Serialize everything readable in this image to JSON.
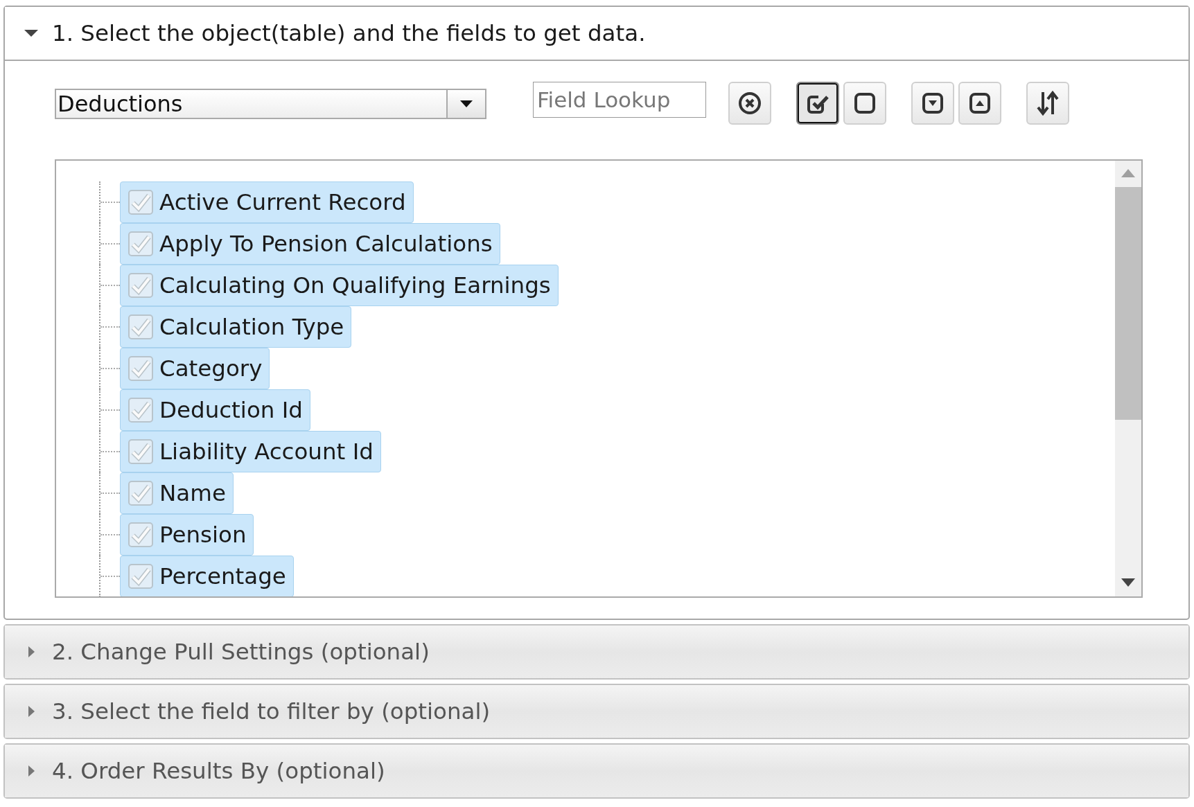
{
  "sections": [
    {
      "title": "1. Select the object(table) and the fields to get data.",
      "expanded": true,
      "object_select": {
        "value": "Deductions"
      },
      "field_lookup": {
        "placeholder": "Field Lookup"
      },
      "toolbar": [
        {
          "kind": "clear",
          "pressed": false
        },
        {
          "kind": "check-all",
          "pressed": true
        },
        {
          "kind": "uncheck-all",
          "pressed": false
        },
        {
          "kind": "expand",
          "pressed": false
        },
        {
          "kind": "collapse",
          "pressed": false
        },
        {
          "kind": "sort",
          "pressed": false
        }
      ],
      "fields": [
        {
          "label": "Active Current Record",
          "checked": true,
          "selected": true
        },
        {
          "label": "Apply To Pension Calculations",
          "checked": true,
          "selected": true
        },
        {
          "label": "Calculating On Qualifying Earnings",
          "checked": true,
          "selected": true
        },
        {
          "label": "Calculation Type",
          "checked": true,
          "selected": true
        },
        {
          "label": "Category",
          "checked": true,
          "selected": true
        },
        {
          "label": "Deduction Id",
          "checked": true,
          "selected": true
        },
        {
          "label": "Liability Account Id",
          "checked": true,
          "selected": true
        },
        {
          "label": "Name",
          "checked": true,
          "selected": true
        },
        {
          "label": "Pension",
          "checked": true,
          "selected": true
        },
        {
          "label": "Percentage",
          "checked": true,
          "selected": true
        }
      ]
    },
    {
      "title": "2. Change Pull Settings (optional)",
      "expanded": false
    },
    {
      "title": "3. Select the field to filter by (optional)",
      "expanded": false
    },
    {
      "title": "4. Order Results By (optional)",
      "expanded": false
    }
  ]
}
